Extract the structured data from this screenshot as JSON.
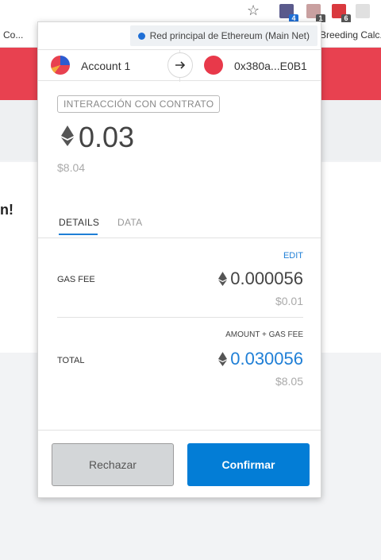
{
  "browser": {
    "bookmark_left": "Co...",
    "bookmark_right": "Breeding Calc...",
    "partial_page_text": "n!",
    "extension_badges": [
      "4",
      "1",
      "6"
    ]
  },
  "popup": {
    "network": "Red principal de Ethereum (Main Net)",
    "from_account": "Account 1",
    "to_address": "0x380a...E0B1",
    "contract_badge": "INTERACCIÓN CON CONTRATO",
    "amount": "0.03",
    "amount_fiat": "$8.04",
    "tabs": {
      "details": "DETAILS",
      "data": "DATA"
    },
    "edit_label": "EDIT",
    "gas_fee_label": "GAS FEE",
    "gas_fee_value": "0.000056",
    "gas_fee_fiat": "$0.01",
    "total_caption": "AMOUNT + GAS FEE",
    "total_label": "TOTAL",
    "total_value": "0.030056",
    "total_fiat": "$8.05",
    "reject_button": "Rechazar",
    "confirm_button": "Confirmar"
  },
  "colors": {
    "accent": "#037dd6",
    "brand_red": "#e84150",
    "network_dot": "#1f6fd6"
  }
}
